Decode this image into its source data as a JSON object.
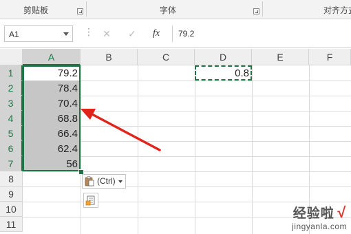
{
  "ribbon": {
    "groups": [
      "剪贴板",
      "字体",
      "对齐方式"
    ]
  },
  "formula_bar": {
    "name_box": "A1",
    "cancel_glyph": "✕",
    "enter_glyph": "✓",
    "fx_label": "fx",
    "value": "79.2"
  },
  "sheet": {
    "columns": [
      "A",
      "B",
      "C",
      "D",
      "E",
      "F"
    ],
    "rows": [
      "1",
      "2",
      "3",
      "4",
      "5",
      "6",
      "7",
      "8",
      "9",
      "10",
      "11"
    ],
    "column_a_values": [
      "79.2",
      "78.4",
      "70.4",
      "68.8",
      "66.4",
      "62.4",
      "56"
    ],
    "d1_value": "0.8",
    "selected_range": "A1:A7",
    "copied_cell": "D1"
  },
  "paste_options": {
    "label": "(Ctrl)"
  },
  "watermark": {
    "title": "经验啦",
    "check": "√",
    "url": "jingyanla.com"
  },
  "colors": {
    "selection": "#217346",
    "highlight": "#c6c6c6",
    "arrow": "#e0241b"
  }
}
